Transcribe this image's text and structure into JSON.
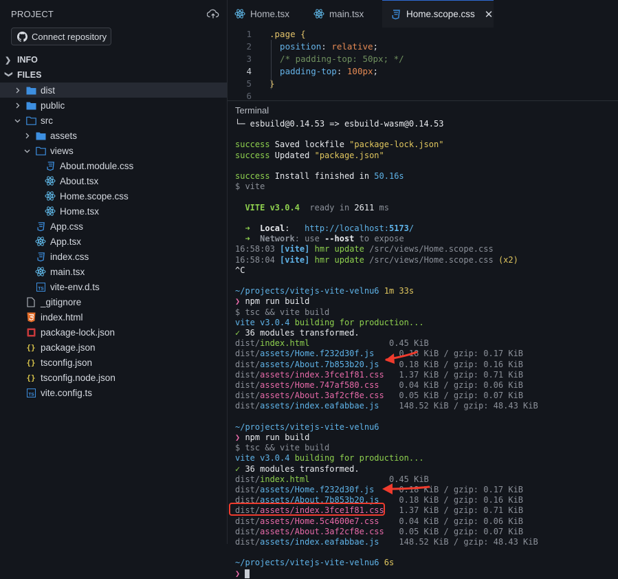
{
  "sidebar": {
    "header": "PROJECT",
    "connect_label": "Connect repository",
    "sections": {
      "info": "INFO",
      "files": "FILES"
    },
    "tree": [
      {
        "label": "dist",
        "type": "folder",
        "depth": 0,
        "expanded": false,
        "selected": true
      },
      {
        "label": "public",
        "type": "folder",
        "depth": 0,
        "expanded": false
      },
      {
        "label": "src",
        "type": "folder-open",
        "depth": 0,
        "expanded": true
      },
      {
        "label": "assets",
        "type": "folder",
        "depth": 1,
        "expanded": false
      },
      {
        "label": "views",
        "type": "folder-open",
        "depth": 1,
        "expanded": true
      },
      {
        "label": "About.module.css",
        "type": "css",
        "depth": 2
      },
      {
        "label": "About.tsx",
        "type": "react",
        "depth": 2
      },
      {
        "label": "Home.scope.css",
        "type": "react",
        "depth": 2
      },
      {
        "label": "Home.tsx",
        "type": "react",
        "depth": 2
      },
      {
        "label": "App.css",
        "type": "css",
        "depth": 1
      },
      {
        "label": "App.tsx",
        "type": "react",
        "depth": 1
      },
      {
        "label": "index.css",
        "type": "css",
        "depth": 1
      },
      {
        "label": "main.tsx",
        "type": "react",
        "depth": 1
      },
      {
        "label": "vite-env.d.ts",
        "type": "ts",
        "depth": 1
      },
      {
        "label": "_gitignore",
        "type": "file",
        "depth": 0
      },
      {
        "label": "index.html",
        "type": "html",
        "depth": 0
      },
      {
        "label": "package-lock.json",
        "type": "lock",
        "depth": 0
      },
      {
        "label": "package.json",
        "type": "json",
        "depth": 0
      },
      {
        "label": "tsconfig.json",
        "type": "json",
        "depth": 0
      },
      {
        "label": "tsconfig.node.json",
        "type": "json",
        "depth": 0
      },
      {
        "label": "vite.config.ts",
        "type": "ts",
        "depth": 0
      }
    ]
  },
  "tabs": [
    {
      "label": "Home.tsx",
      "icon": "react-icon",
      "active": false
    },
    {
      "label": "main.tsx",
      "icon": "react-icon",
      "active": false
    },
    {
      "label": "Home.scope.css",
      "icon": "css-icon",
      "active": true
    }
  ],
  "editor": {
    "lines": [
      {
        "n": "1",
        "parts": [
          [
            "sel",
            ".page "
          ],
          [
            "brace",
            "{"
          ]
        ]
      },
      {
        "n": "2",
        "parts": [
          [
            "prop",
            "  position"
          ],
          [
            "punc",
            ": "
          ],
          [
            "val",
            "relative"
          ],
          [
            "punc",
            ";"
          ]
        ]
      },
      {
        "n": "3",
        "parts": [
          [
            "comment",
            "  /* padding-top: 50px; */"
          ]
        ]
      },
      {
        "n": "4",
        "parts": [
          [
            "prop",
            "  padding-top"
          ],
          [
            "punc",
            ": "
          ],
          [
            "val",
            "100px"
          ],
          [
            "punc",
            ";"
          ]
        ],
        "current": true
      },
      {
        "n": "5",
        "parts": [
          [
            "brace",
            "}"
          ]
        ]
      },
      {
        "n": "6",
        "parts": []
      }
    ]
  },
  "terminal": {
    "title": "Terminal",
    "lines": [
      [
        [
          "white",
          "└─ esbuild@0.14.53 => esbuild-wasm@0.14.53"
        ]
      ],
      [],
      [
        [
          "green",
          "success"
        ],
        [
          "white",
          " Saved lockfile "
        ],
        [
          "yellow",
          "\"package-lock.json\""
        ]
      ],
      [
        [
          "green",
          "success"
        ],
        [
          "white",
          " Updated "
        ],
        [
          "yellow",
          "\"package.json\""
        ]
      ],
      [],
      [
        [
          "green",
          "success"
        ],
        [
          "white",
          " Install finished in "
        ],
        [
          "cyan",
          "50.16s"
        ]
      ],
      [
        [
          "grey",
          "$ vite"
        ]
      ],
      [],
      [
        [
          "green bold",
          "  VITE v3.0.4"
        ],
        [
          "grey",
          "  ready in "
        ],
        [
          "white",
          "2611"
        ],
        [
          "grey",
          " ms"
        ]
      ],
      [],
      [
        [
          "green",
          "  ➜  "
        ],
        [
          "white bold",
          "Local"
        ],
        [
          "white",
          ":   "
        ],
        [
          "cyan",
          "http://localhost:"
        ],
        [
          "cyan bold",
          "5173"
        ],
        [
          "cyan",
          "/"
        ]
      ],
      [
        [
          "green",
          "  ➜  "
        ],
        [
          "grey bold",
          "Network"
        ],
        [
          "grey",
          ": use "
        ],
        [
          "white bold",
          "--host"
        ],
        [
          "grey",
          " to expose"
        ]
      ],
      [
        [
          "grey",
          "16:58:03 "
        ],
        [
          "cyan bold",
          "[vite]"
        ],
        [
          "green",
          " hmr update "
        ],
        [
          "grey",
          "/src/views/Home.scope.css"
        ]
      ],
      [
        [
          "grey",
          "16:58:04 "
        ],
        [
          "cyan bold",
          "[vite]"
        ],
        [
          "green",
          " hmr update "
        ],
        [
          "grey",
          "/src/views/Home.scope.css "
        ],
        [
          "yellow",
          "(x2)"
        ]
      ],
      [
        [
          "white",
          "^C"
        ]
      ],
      [],
      [
        [
          "cyan",
          "~/projects/vitejs-vite-velnu6 "
        ],
        [
          "yellow",
          "1m 33s"
        ]
      ],
      [
        [
          "pink",
          "❯ "
        ],
        [
          "white",
          "npm run build"
        ]
      ],
      [
        [
          "grey",
          "$ tsc && vite build"
        ]
      ],
      [
        [
          "cyan",
          "vite v3.0.4 "
        ],
        [
          "green",
          "building for production..."
        ]
      ],
      [
        [
          "green",
          "✓ "
        ],
        [
          "white",
          "36 modules transformed."
        ]
      ],
      [
        [
          "grey",
          "dist/"
        ],
        [
          "green",
          "index.html"
        ],
        [
          "grey",
          "                0.45 KiB"
        ]
      ],
      [
        [
          "grey",
          "dist/"
        ],
        [
          "cyan",
          "assets/Home.f232d30f.js"
        ],
        [
          "grey",
          "     0.18 KiB / gzip: 0.17 KiB"
        ]
      ],
      [
        [
          "grey",
          "dist/"
        ],
        [
          "cyan",
          "assets/About.7b853b20.js"
        ],
        [
          "grey",
          "    0.18 KiB / gzip: 0.16 KiB"
        ]
      ],
      [
        [
          "grey",
          "dist/"
        ],
        [
          "pink",
          "assets/index.3fce1f81.css"
        ],
        [
          "grey",
          "   1.37 KiB / gzip: 0.71 KiB"
        ]
      ],
      [
        [
          "grey",
          "dist/"
        ],
        [
          "pink",
          "assets/Home.747af580.css"
        ],
        [
          "grey",
          "    0.04 KiB / gzip: 0.06 KiB"
        ]
      ],
      [
        [
          "grey",
          "dist/"
        ],
        [
          "pink",
          "assets/About.3af2cf8e.css"
        ],
        [
          "grey",
          "   0.05 KiB / gzip: 0.07 KiB"
        ]
      ],
      [
        [
          "grey",
          "dist/"
        ],
        [
          "cyan",
          "assets/index.eafabbae.js"
        ],
        [
          "grey",
          "    148.52 KiB / gzip: 48.43 KiB"
        ]
      ],
      [],
      [
        [
          "cyan",
          "~/projects/vitejs-vite-velnu6"
        ]
      ],
      [
        [
          "pink",
          "❯ "
        ],
        [
          "white",
          "npm run build"
        ]
      ],
      [
        [
          "grey",
          "$ tsc && vite build"
        ]
      ],
      [
        [
          "cyan",
          "vite v3.0.4 "
        ],
        [
          "green",
          "building for production..."
        ]
      ],
      [
        [
          "green",
          "✓ "
        ],
        [
          "white",
          "36 modules transformed."
        ]
      ],
      [
        [
          "grey",
          "dist/"
        ],
        [
          "green",
          "index.html"
        ],
        [
          "grey",
          "                0.45 KiB"
        ]
      ],
      [
        [
          "grey",
          "dist/"
        ],
        [
          "cyan",
          "assets/Home.f232d30f.js"
        ],
        [
          "grey",
          "     0.18 KiB / gzip: 0.17 KiB"
        ]
      ],
      [
        [
          "grey",
          "dist/"
        ],
        [
          "cyan",
          "assets/About.7b853b20.js"
        ],
        [
          "grey",
          "    0.18 KiB / gzip: 0.16 KiB"
        ]
      ],
      [
        [
          "grey",
          "dist/"
        ],
        [
          "pink",
          "assets/index.3fce1f81.css"
        ],
        [
          "grey",
          "   1.37 KiB / gzip: 0.71 KiB"
        ]
      ],
      [
        [
          "grey",
          "dist/"
        ],
        [
          "pink",
          "assets/Home.5c4600e7.css"
        ],
        [
          "grey",
          "    0.04 KiB / gzip: 0.06 KiB"
        ]
      ],
      [
        [
          "grey",
          "dist/"
        ],
        [
          "pink",
          "assets/About.3af2cf8e.css"
        ],
        [
          "grey",
          "   0.05 KiB / gzip: 0.07 KiB"
        ]
      ],
      [
        [
          "grey",
          "dist/"
        ],
        [
          "cyan",
          "assets/index.eafabbae.js"
        ],
        [
          "grey",
          "    148.52 KiB / gzip: 48.43 KiB"
        ]
      ],
      [],
      [
        [
          "cyan",
          "~/projects/vitejs-vite-velnu6 "
        ],
        [
          "yellow",
          "6s"
        ]
      ],
      [
        [
          "pink",
          "❯ "
        ],
        [
          "cursor",
          ""
        ]
      ]
    ]
  },
  "annotations": {
    "arrow_color": "#ef3b2d"
  }
}
